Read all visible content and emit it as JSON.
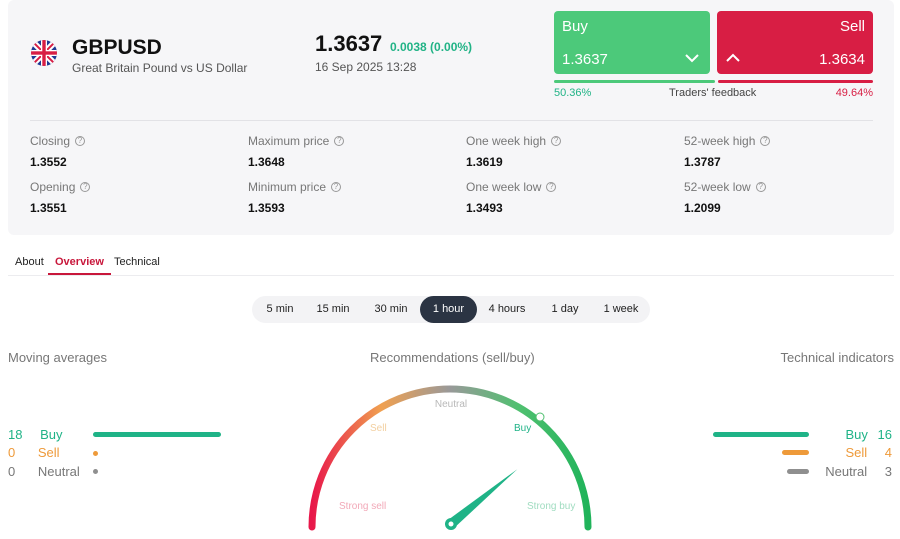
{
  "colors": {
    "buy": "#4cc97a",
    "sell": "#d81e44",
    "neutral": "#8f8f8f",
    "accent": "#c8173b",
    "up": "#21b386",
    "ma_buy": "#1fb387",
    "sell_orange": "#ee9a3a"
  },
  "header": {
    "symbol": "GBPUSD",
    "fullname": "Great Britain Pound vs US Dollar",
    "flag_icon": "uk-flag-icon",
    "price": "1.3637",
    "change": "0.0038 (0.00%)",
    "datetime": "16 Sep 2025 13:28"
  },
  "trade": {
    "buy_label": "Buy",
    "buy_price": "1.3637",
    "sell_label": "Sell",
    "sell_price": "1.3634",
    "feedback_label": "Traders' feedback",
    "buy_pct": "50.36%",
    "sell_pct": "49.64%",
    "buy_share": 0.5036
  },
  "stats": [
    {
      "label": "Closing",
      "value": "1.3552"
    },
    {
      "label": "Maximum price",
      "value": "1.3648"
    },
    {
      "label": "One week high",
      "value": "1.3619"
    },
    {
      "label": "52-week high",
      "value": "1.3787"
    },
    {
      "label": "Opening",
      "value": "1.3551"
    },
    {
      "label": "Minimum price",
      "value": "1.3593"
    },
    {
      "label": "One week low",
      "value": "1.3493"
    },
    {
      "label": "52-week low",
      "value": "1.2099"
    }
  ],
  "tabs": [
    "About",
    "Overview",
    "Technical"
  ],
  "active_tab": "Overview",
  "periods": [
    "5 min",
    "15 min",
    "30 min",
    "1 hour",
    "4 hours",
    "1 day",
    "1 week"
  ],
  "active_period": "1 hour",
  "moving_averages": {
    "title": "Moving averages",
    "buy": {
      "count": "18",
      "label": "Buy"
    },
    "sell": {
      "count": "0",
      "label": "Sell"
    },
    "neutral": {
      "count": "0",
      "label": "Neutral"
    }
  },
  "recommendations": {
    "title": "Recommendations (sell/buy)",
    "labels": {
      "strong_sell": "Strong sell",
      "sell": "Sell",
      "neutral": "Neutral",
      "buy": "Buy",
      "strong_buy": "Strong buy"
    },
    "needle_value": 0.78
  },
  "technical_indicators": {
    "title": "Technical indicators",
    "buy": {
      "count": "16",
      "label": "Buy"
    },
    "sell": {
      "count": "4",
      "label": "Sell"
    },
    "neutral": {
      "count": "3",
      "label": "Neutral"
    }
  }
}
